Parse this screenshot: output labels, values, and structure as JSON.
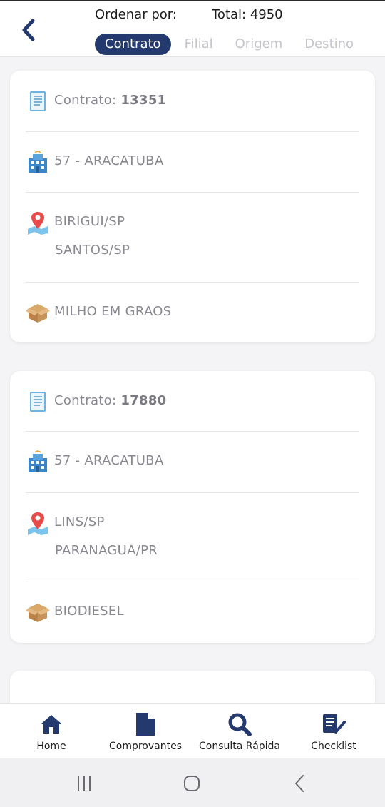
{
  "header": {
    "sort_label": "Ordenar por:",
    "total_label": "Total: 4950",
    "tabs": [
      {
        "label": "Contrato",
        "active": true
      },
      {
        "label": "Filial",
        "active": false
      },
      {
        "label": "Origem",
        "active": false
      },
      {
        "label": "Destino",
        "active": false
      }
    ]
  },
  "cards": [
    {
      "contract_prefix": "Contrato: ",
      "contract_number": "13351",
      "branch": "57 - ARACATUBA",
      "origin": "BIRIGUI/SP",
      "destination": "SANTOS/SP",
      "product": "MILHO EM GRAOS"
    },
    {
      "contract_prefix": "Contrato: ",
      "contract_number": "17880",
      "branch": "57 - ARACATUBA",
      "origin": "LINS/SP",
      "destination": "PARANAGUA/PR",
      "product": "BIODIESEL"
    }
  ],
  "bottom_nav": [
    {
      "label": "Home",
      "icon": "home-icon"
    },
    {
      "label": "Comprovantes",
      "icon": "document-icon"
    },
    {
      "label": "Consulta Rápida",
      "icon": "search-icon"
    },
    {
      "label": "Checklist",
      "icon": "checklist-icon"
    }
  ],
  "colors": {
    "primary": "#243a6e",
    "muted_text": "#888890",
    "inactive_tab": "#c4c4cc",
    "background": "#f4f4f6"
  }
}
